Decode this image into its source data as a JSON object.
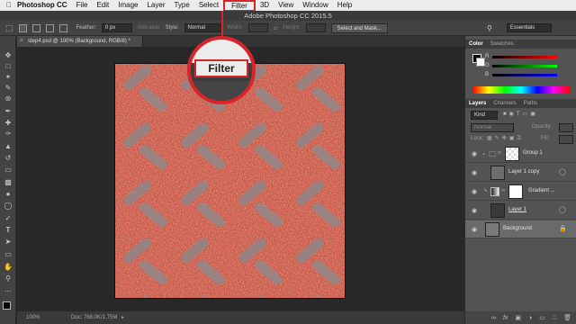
{
  "menubar": {
    "apple": "",
    "app_name": "Photoshop CC",
    "items": [
      "File",
      "Edit",
      "Image",
      "Layer",
      "Type",
      "Select",
      "Filter",
      "3D",
      "View",
      "Window",
      "Help"
    ]
  },
  "window": {
    "title": "Adobe Photoshop CC 2015.5"
  },
  "options": {
    "feather_label": "Feather:",
    "feather_value": "0 px",
    "antialias": "Anti-alias",
    "style_label": "Style:",
    "style_value": "Normal",
    "width_label": "Width:",
    "height_label": "Height:",
    "select_mask": "Select and Mask...",
    "workspace": "Essentials"
  },
  "document": {
    "tab": "step4.psd @ 100% (Background, RGB/8) *"
  },
  "status": {
    "zoom": "100%",
    "doc": "Doc: 768.0K/1.75M"
  },
  "callout": {
    "label": "Filter"
  },
  "color_panel": {
    "tabs": [
      "Color",
      "Swatches"
    ],
    "channels": [
      "R",
      "G",
      "B"
    ]
  },
  "layers_panel": {
    "tabs": [
      "Layers",
      "Channels",
      "Paths"
    ],
    "kind": "Kind",
    "blend": "Normal",
    "opacity_label": "Opacity:",
    "lock_label": "Lock:",
    "fill_label": "Fill:",
    "layers": [
      {
        "name": "Group 1"
      },
      {
        "name": "Layer 1 copy"
      },
      {
        "name": "Gradient ..."
      },
      {
        "name": "Layer 1"
      },
      {
        "name": "Background"
      }
    ]
  },
  "colors": {
    "highlight": "#d9242a",
    "selected_layer": "#6a6a6a",
    "artwork_base": "#b94d3f"
  }
}
